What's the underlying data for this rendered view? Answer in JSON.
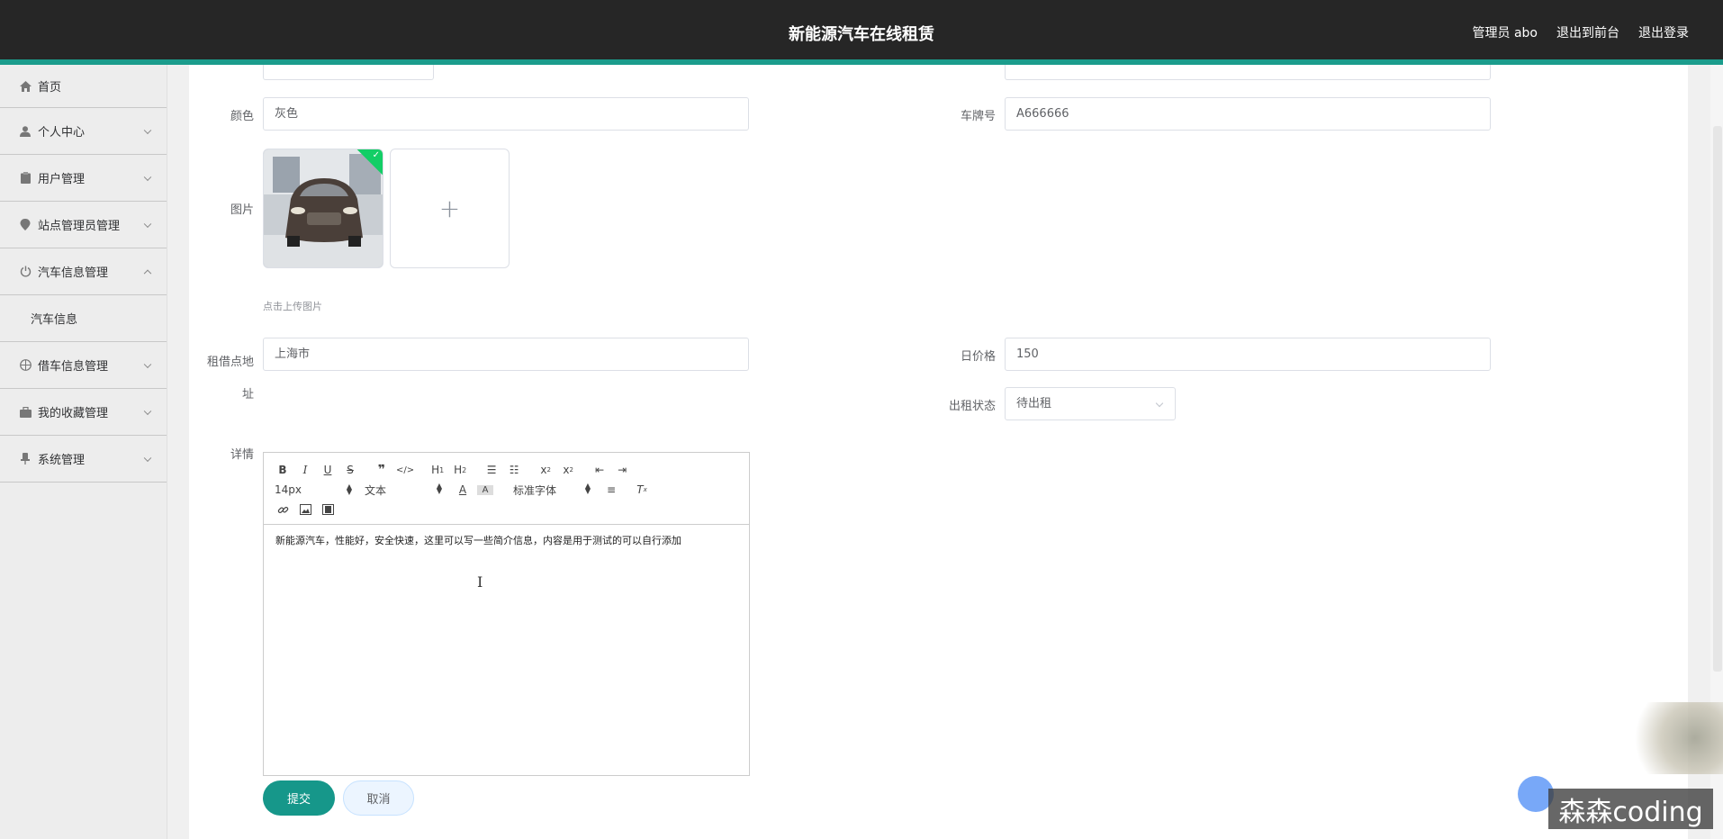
{
  "header": {
    "title": "新能源汽车在线租赁",
    "admin_label": "管理员 abo",
    "front_label": "退出到前台",
    "logout_label": "退出登录",
    "accent_color": "#1b9c8c"
  },
  "sidebar": {
    "items": [
      {
        "label": "首页",
        "icon": "home-icon"
      },
      {
        "label": "个人中心",
        "icon": "user-icon"
      },
      {
        "label": "用户管理",
        "icon": "clipboard-icon"
      },
      {
        "label": "站点管理员管理",
        "icon": "location-icon"
      },
      {
        "label": "汽车信息管理",
        "icon": "power-icon",
        "expanded": true
      },
      {
        "label": "借车信息管理",
        "icon": "globe-icon"
      },
      {
        "label": "我的收藏管理",
        "icon": "briefcase-icon"
      },
      {
        "label": "系统管理",
        "icon": "pin-icon"
      }
    ],
    "subitem_car_info": "汽车信息"
  },
  "form": {
    "color_label": "颜色",
    "color_value": "灰色",
    "plate_label": "车牌号",
    "plate_value": "A666666",
    "image_label": "图片",
    "upload_hint": "点击上传图片",
    "location_label": "租借点地址",
    "location_value": "上海市",
    "price_label": "日价格",
    "price_value": "150",
    "status_label": "出租状态",
    "status_value": "待出租",
    "detail_label": "详情",
    "detail_text": "新能源汽车，性能好，安全快速，这里可以写一些简介信息，内容是用于测试的可以自行添加",
    "toolbar": {
      "size_value": "14px",
      "header_value": "文本",
      "font_value": "标准字体"
    },
    "submit_label": "提交",
    "cancel_label": "取消"
  },
  "watermark": "森森coding"
}
